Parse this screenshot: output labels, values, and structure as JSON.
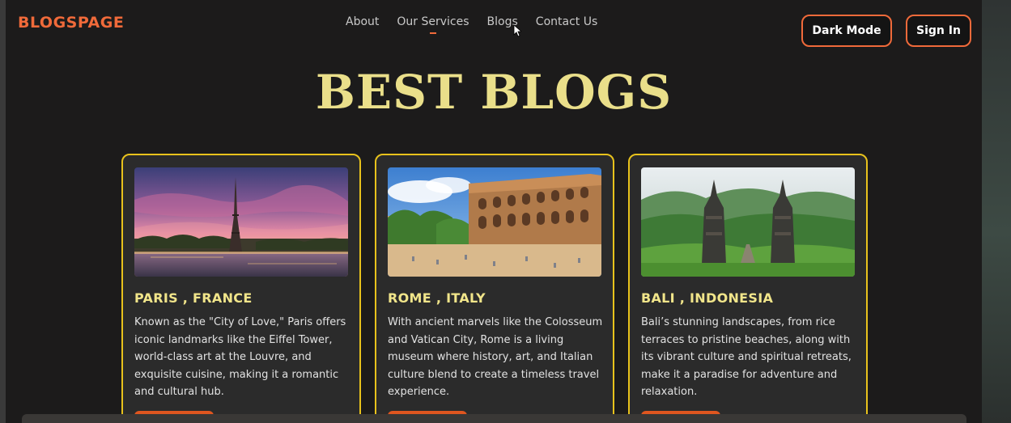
{
  "header": {
    "logo": "BLOGSPAGE",
    "nav": [
      {
        "label": "About"
      },
      {
        "label": "Our Services"
      },
      {
        "label": "Blogs"
      },
      {
        "label": "Contact Us"
      }
    ],
    "dark_mode_label": "Dark Mode",
    "sign_in_label": "Sign In"
  },
  "hero": {
    "title": "BEST BLOGS"
  },
  "cards": [
    {
      "title": "PARIS , FRANCE",
      "text": "Known as the \"City of Love,\" Paris offers\niconic landmarks like the Eiffel Tower,\nworld-class art at the Louvre, and\nexquisite cuisine, making it a romantic\nand cultural hub."
    },
    {
      "title": "ROME , ITALY",
      "text": "With ancient marvels like the Colosseum\nand Vatican City, Rome is a living\nmuseum where history, art, and Italian\nculture blend to create a timeless travel\nexperience."
    },
    {
      "title": "BALI , INDONESIA",
      "text": "Bali’s stunning landscapes, from rice\nterraces to pristine beaches, along with\nits vibrant culture and spiritual retreats,\nmake it a paradise for adventure and\nrelaxation."
    }
  ],
  "colors": {
    "accent": "#f06a3a",
    "heading": "#eadf8a",
    "card_border": "#e8c21c",
    "card_title": "#f1e58a",
    "card_button": "#e0561f"
  },
  "icons": [
    "mouse-cursor-icon"
  ]
}
